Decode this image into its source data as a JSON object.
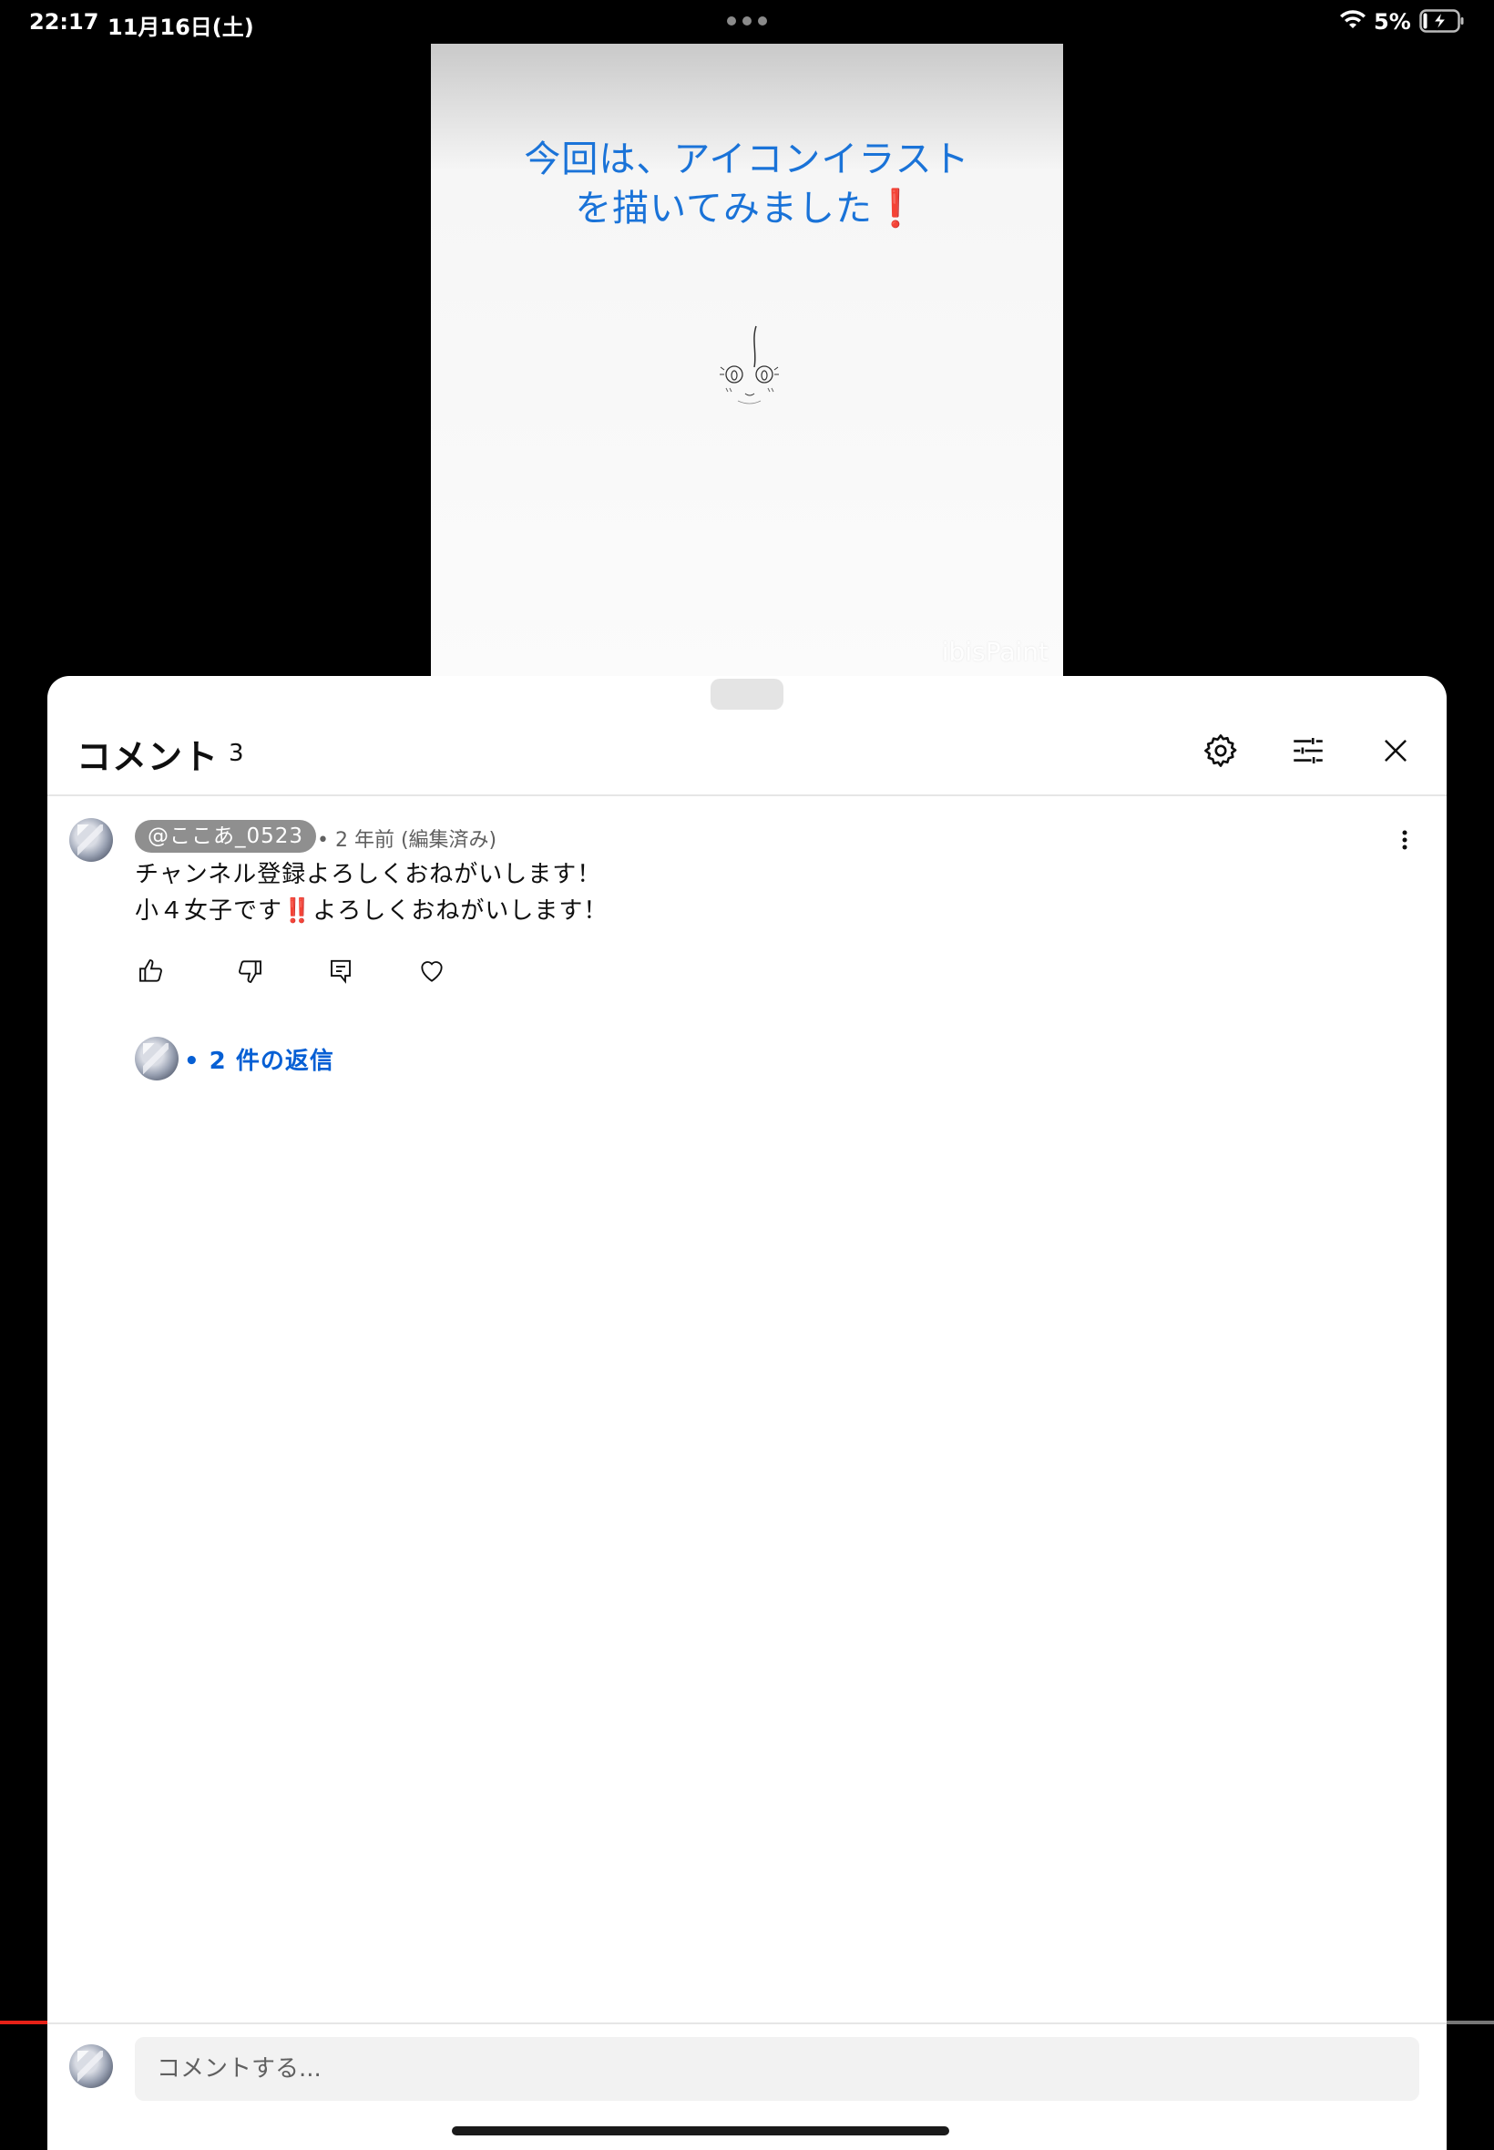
{
  "status_bar": {
    "time": "22:17",
    "date": "11月16日(土)",
    "battery_percent": "5%"
  },
  "video": {
    "caption_line1": "今回は、アイコンイラスト",
    "caption_line2": "を描いてみました",
    "caption_emoji": "❗",
    "watermark": "ibisPaint"
  },
  "comments_panel": {
    "title": "コメント",
    "count": "3",
    "icons": [
      "gear-icon",
      "filter-icon",
      "close-icon"
    ]
  },
  "comment": {
    "author": "@ここあ_0523",
    "meta": "• 2 年前 (編集済み)",
    "line1": "チャンネル登録よろしくおねがいします！",
    "line2_pre": "小４女子です",
    "line2_emoji": "‼️",
    "line2_post": "よろしくおねがいします！",
    "reply_link": "• 2 件の返信"
  },
  "compose": {
    "placeholder": "コメントする..."
  },
  "colors": {
    "caption_blue": "#1a73d8",
    "link_blue": "#065fd4",
    "accent_red": "#e31b1b"
  }
}
